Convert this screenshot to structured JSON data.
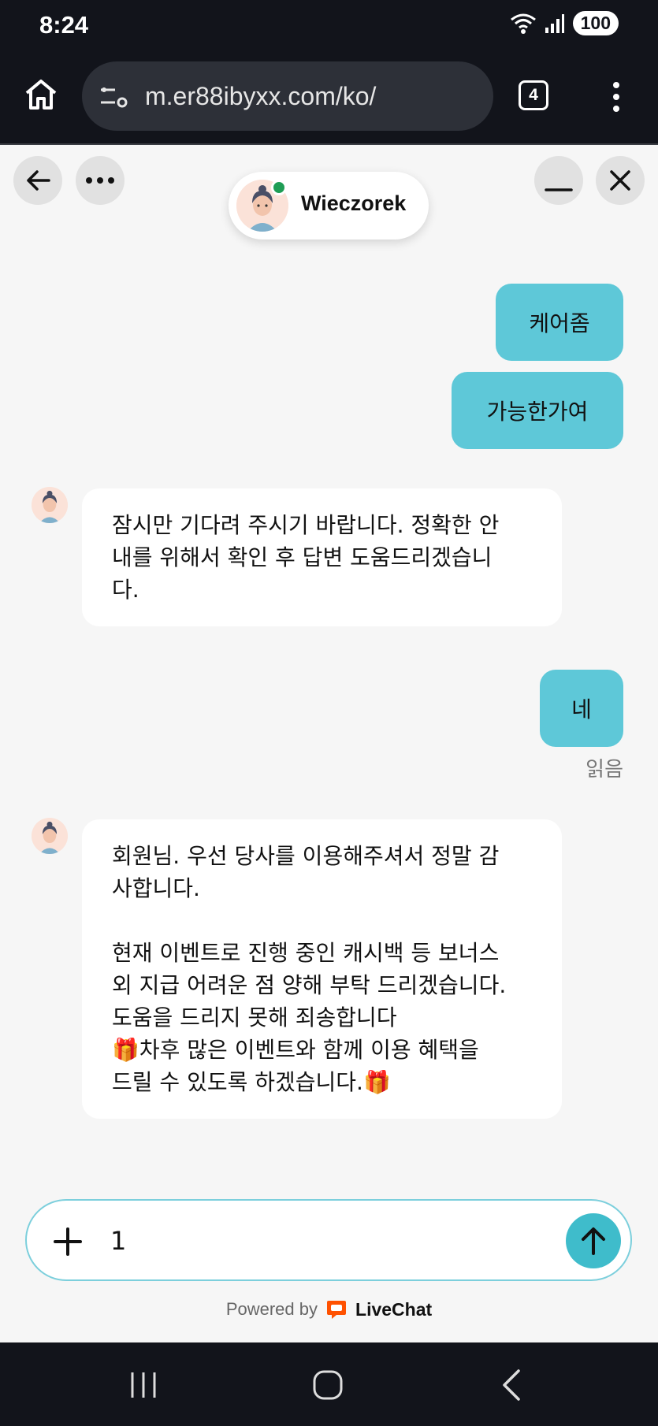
{
  "status_bar": {
    "time": "8:24",
    "battery": "100",
    "icons": [
      "wifi-icon",
      "signal-icon"
    ]
  },
  "browser": {
    "url": "m.er88ibyxx.com/ko/",
    "tab_count": "4",
    "icons": [
      "home-icon",
      "tune-icon",
      "more-vertical-icon"
    ]
  },
  "chat_header": {
    "agent_name": "Wieczorek",
    "agent_online": true,
    "icons": [
      "back-arrow-icon",
      "more-horizontal-icon",
      "minimize-icon",
      "close-icon"
    ]
  },
  "messages": [
    {
      "from": "visitor",
      "text": "케어좀"
    },
    {
      "from": "visitor",
      "text": "가능한가여"
    },
    {
      "from": "agent",
      "text": "잠시만 기다려 주시기 바랍니다. 정확한 안\n내를 위해서 확인 후 답변 도움드리겠습니\n다."
    },
    {
      "from": "visitor",
      "text": "네"
    },
    {
      "from": "agent",
      "text": "회원님. 우선 당사를 이용해주셔서 정말 감\n사합니다.\n\n현재 이벤트로 진행 중인 캐시백 등 보너스\n외 지급 어려운 점 양해 부탁 드리겠습니다.\n도움을 드리지 못해 죄송합니다\n🎁차후 많은 이벤트와 함께 이용 혜택을\n드릴 수 있도록 하겠습니다.🎁"
    }
  ],
  "read_status": "읽음",
  "composer": {
    "value": "1",
    "icons": [
      "plus-icon",
      "send-arrow-icon"
    ]
  },
  "footer": {
    "powered_by": "Powered by",
    "brand": "LiveChat",
    "brand_color": "#ff5100"
  },
  "colors": {
    "visitor_bubble": "#5ec8d8",
    "send_button": "#3fbccb",
    "system_bar": "#12141b"
  },
  "nav_bar": {
    "icons": [
      "recent-apps-icon",
      "home-circle-icon",
      "back-chevron-icon"
    ]
  }
}
